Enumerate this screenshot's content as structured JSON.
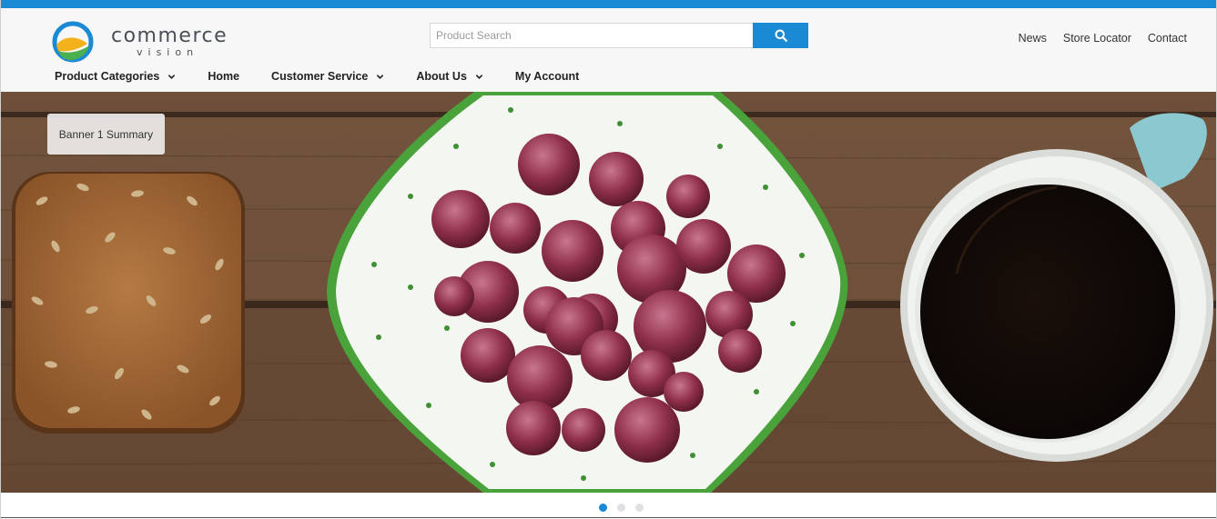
{
  "brand": {
    "name": "commerce",
    "tagline": "vision"
  },
  "search": {
    "placeholder": "Product Search",
    "button_icon": "search-icon"
  },
  "utility_nav": [
    "News",
    "Store Locator",
    "Contact"
  ],
  "main_nav": [
    {
      "label": "Product Categories",
      "has_dropdown": true
    },
    {
      "label": "Home",
      "has_dropdown": false
    },
    {
      "label": "Customer Service",
      "has_dropdown": true
    },
    {
      "label": "About Us",
      "has_dropdown": true
    },
    {
      "label": "My Account",
      "has_dropdown": false
    }
  ],
  "banner": {
    "summary": "Banner 1 Summary",
    "image": "bread, frozen raspberries in green-rimmed bowl, black coffee on wooden table"
  },
  "carousel": {
    "slide_count": 3,
    "active_slide": 1
  },
  "colors": {
    "accent": "#1a8ad4",
    "header_bg": "#f7f7f7"
  }
}
